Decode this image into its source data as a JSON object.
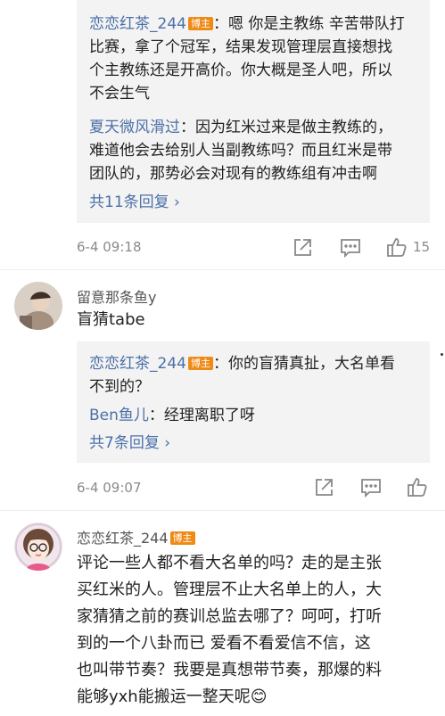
{
  "comment1": {
    "replies": [
      {
        "user": "恋恋红茶_244",
        "badge": "博主",
        "lines": [
          "：嗯 你是主教练 辛苦带队打",
          "比赛，拿了个冠军，结果发现管理层直接想找",
          "个主教练还是开高价。你大概是圣人吧，所以",
          "不会生气"
        ]
      },
      {
        "user": "夏天微风滑过",
        "lines": [
          "：因为红米过来是做主教练的，",
          "难道他会去给别人当副教练吗？而且红米是带",
          "团队的，那势必会对现有的教练组有冲击啊"
        ]
      }
    ],
    "more": "共11条回复 ›",
    "time": "6-4 09:18",
    "like_count": "15"
  },
  "comment2": {
    "user": "留意那条鱼y",
    "text": "盲猜tabe",
    "replies": [
      {
        "user": "恋恋红茶_244",
        "badge": "博主",
        "lines": [
          "：你的盲猜真扯，大名单看",
          "不到的？"
        ]
      },
      {
        "user": "Ben鱼儿",
        "lines": [
          "：经理离职了呀"
        ]
      }
    ],
    "more": "共7条回复 ›",
    "time": "6-4 09:07"
  },
  "comment3": {
    "user": "恋恋红茶_244",
    "badge": "博主",
    "lines": [
      "评论一些人都不看大名单的吗？走的是主张",
      "买红米的人。管理层不止大名单上的人，大",
      "家猜猜之前的赛训总监去哪了？呵呵，打听",
      "到的一个八卦而已 爱看不看爱信不信，这",
      "也叫带节奏？我要是真想带节奏，那爆的料",
      "能够yxh能搬运一整天呢😊"
    ]
  },
  "icons": {
    "share": "share-icon",
    "comment": "comment-icon",
    "like": "thumbs-up-icon"
  },
  "colors": {
    "name": "#4b70a8",
    "badge": "#f08a17",
    "reply_bg": "#f3f3f3",
    "meta": "#8a8a8a"
  }
}
